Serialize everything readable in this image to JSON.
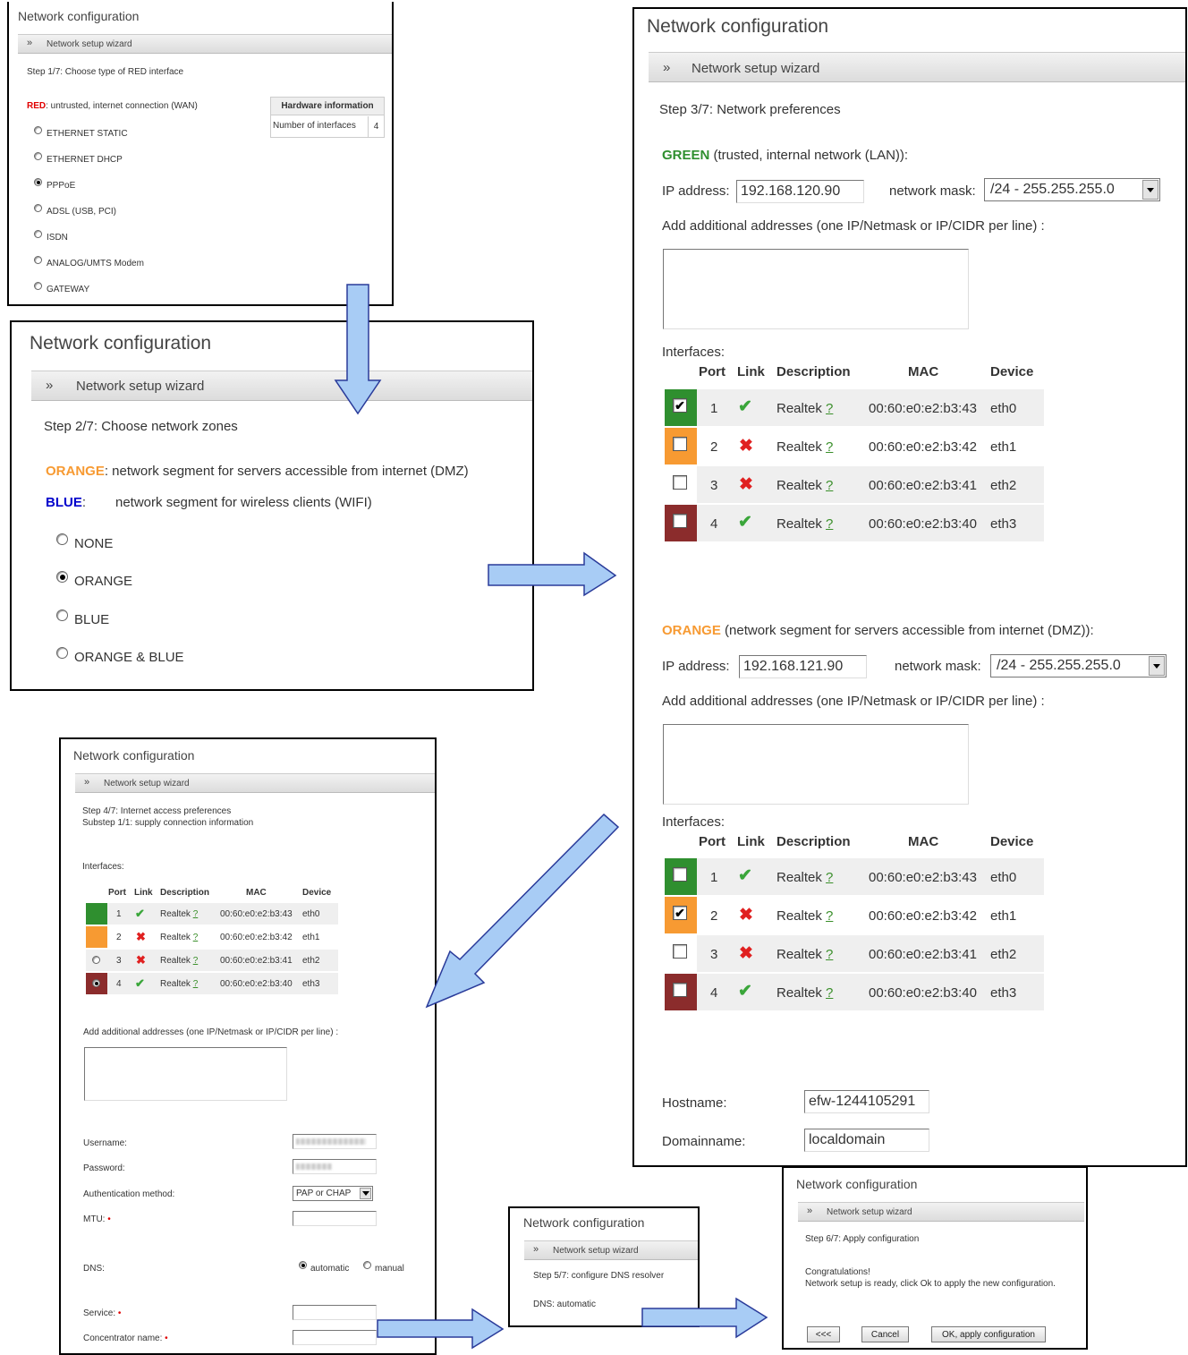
{
  "colors": {
    "green": "#2f8f2f",
    "orange": "#f79a32",
    "blue": "#0000cc",
    "red": "#e00000",
    "darkred": "#8b2c2c",
    "arrow": "#a8ccf5"
  },
  "icons": {
    "check": "✔",
    "cross": "✖",
    "chevrons": "»"
  },
  "step1": {
    "title": "Network configuration",
    "wizard": "Network setup wizard",
    "step": "Step 1/7: Choose type of RED interface",
    "red_label": "RED",
    "red_desc": ": untrusted, internet connection (WAN)",
    "options": [
      "ETHERNET STATIC",
      "ETHERNET DHCP",
      "PPPoE",
      "ADSL (USB, PCI)",
      "ISDN",
      "ANALOG/UMTS Modem",
      "GATEWAY"
    ],
    "selected": "PPPoE",
    "hw_header": "Hardware information",
    "hw_label": "Number of interfaces",
    "hw_value": "4"
  },
  "step2": {
    "title": "Network configuration",
    "wizard": "Network setup wizard",
    "step": "Step 2/7: Choose network zones",
    "orange_label": "ORANGE",
    "orange_desc": ": network segment for servers accessible from internet (DMZ)",
    "blue_label": "BLUE",
    "blue_colon": ":",
    "blue_desc": "network segment for wireless clients (WIFI)",
    "options": [
      "NONE",
      "ORANGE",
      "BLUE",
      "ORANGE & BLUE"
    ],
    "selected": "ORANGE"
  },
  "step3": {
    "title": "Network configuration",
    "wizard": "Network setup wizard",
    "step": "Step 3/7: Network preferences",
    "green_heading": "GREEN",
    "green_heading_rest": " (trusted, internal network (LAN)):",
    "orange_heading": "ORANGE",
    "orange_heading_rest": " (network segment for servers accessible from internet (DMZ)):",
    "ip_label": "IP address:",
    "mask_label": "network mask:",
    "green_ip": "192.168.120.90",
    "orange_ip": "192.168.121.90",
    "mask_value": "/24 - 255.255.255.0",
    "add_label": "Add additional addresses (one IP/Netmask or IP/CIDR per line) :",
    "interfaces_label": "Interfaces:",
    "columns": [
      "Port",
      "Link",
      "Description",
      "MAC",
      "Device"
    ],
    "rows": [
      {
        "port": "1",
        "desc": "Realtek",
        "help": "?",
        "mac": "00:60:e0:e2:b3:43",
        "device": "eth0"
      },
      {
        "port": "2",
        "desc": "Realtek",
        "help": "?",
        "mac": "00:60:e0:e2:b3:42",
        "device": "eth1"
      },
      {
        "port": "3",
        "desc": "Realtek",
        "help": "?",
        "mac": "00:60:e0:e2:b3:41",
        "device": "eth2"
      },
      {
        "port": "4",
        "desc": "Realtek",
        "help": "?",
        "mac": "00:60:e0:e2:b3:40",
        "device": "eth3"
      }
    ],
    "hostname_label": "Hostname:",
    "hostname_value": "efw-1244105291",
    "domain_label": "Domainname:",
    "domain_value": "localdomain"
  },
  "step4": {
    "title": "Network configuration",
    "wizard": "Network setup wizard",
    "step": "Step 4/7: Internet access preferences",
    "substep": "Substep 1/1: supply connection information",
    "interfaces_label": "Interfaces:",
    "columns": [
      "Port",
      "Link",
      "Description",
      "MAC",
      "Device"
    ],
    "rows": [
      {
        "port": "1",
        "desc": "Realtek",
        "help": "?",
        "mac": "00:60:e0:e2:b3:43",
        "device": "eth0"
      },
      {
        "port": "2",
        "desc": "Realtek",
        "help": "?",
        "mac": "00:60:e0:e2:b3:42",
        "device": "eth1"
      },
      {
        "port": "3",
        "desc": "Realtek",
        "help": "?",
        "mac": "00:60:e0:e2:b3:41",
        "device": "eth2"
      },
      {
        "port": "4",
        "desc": "Realtek",
        "help": "?",
        "mac": "00:60:e0:e2:b3:40",
        "device": "eth3"
      }
    ],
    "add_label": "Add additional addresses (one IP/Netmask or IP/CIDR per line) :",
    "username_label": "Username:",
    "password_label": "Password:",
    "auth_label": "Authentication method:",
    "auth_value": "PAP or CHAP",
    "mtu_label": "MTU:",
    "dns_label": "DNS:",
    "dns_auto": "automatic",
    "dns_manual": "manual",
    "service_label": "Service:",
    "concentrator_label": "Concentrator name:",
    "required_mark": "•"
  },
  "step5": {
    "title": "Network configuration",
    "wizard": "Network setup wizard",
    "step": "Step 5/7: configure DNS resolver",
    "dns": "DNS:  automatic"
  },
  "step6": {
    "title": "Network configuration",
    "wizard": "Network setup wizard",
    "step": "Step 6/7: Apply configuration",
    "congrats": "Congratulations!",
    "message": "Network setup is ready, click Ok to apply the new configuration.",
    "back_button": "<<<",
    "cancel_button": "Cancel",
    "ok_button": "OK, apply configuration"
  }
}
